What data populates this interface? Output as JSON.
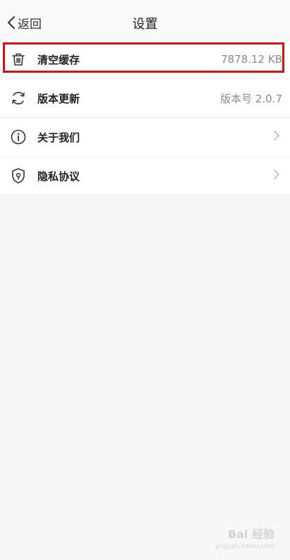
{
  "nav": {
    "back_label": "返回",
    "title": "设置"
  },
  "settings": {
    "items": [
      {
        "label": "清空缓存",
        "value": "7878.12 KB",
        "icon": "trash-icon"
      },
      {
        "label": "版本更新",
        "value": "版本号 2.0.7",
        "icon": "refresh-icon"
      },
      {
        "label": "关于我们",
        "value": "",
        "icon": "info-icon"
      },
      {
        "label": "隐私协议",
        "value": "",
        "icon": "shield-icon"
      }
    ]
  },
  "watermark": {
    "brand": "Bai 经验",
    "url": "jingyan.baidu.com"
  },
  "colors": {
    "highlight": "#d90e0e",
    "background": "#f7f7f7",
    "row_background": "#ffffff",
    "secondary_text": "#8a8a8a"
  }
}
